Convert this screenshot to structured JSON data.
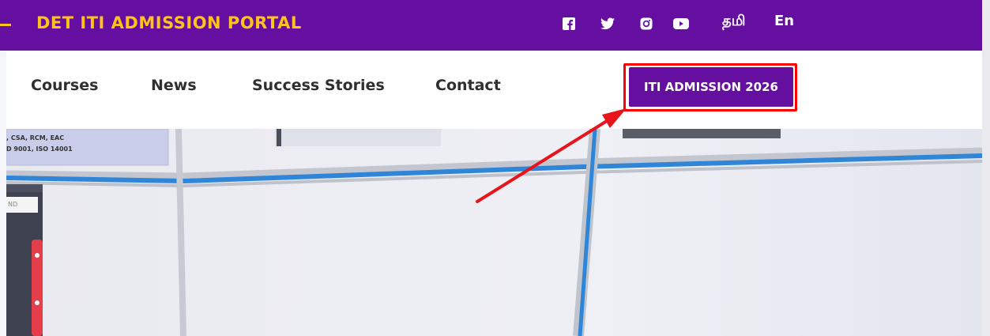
{
  "header": {
    "brand": "DET ITI ADMISSION PORTAL",
    "social_icons": [
      "facebook-icon",
      "twitter-icon",
      "instagram-icon",
      "youtube-icon"
    ],
    "languages": [
      "தமி",
      "En"
    ]
  },
  "nav": {
    "items": [
      "Courses",
      "News",
      "Success Stories",
      "Contact"
    ],
    "cta": "ITI ADMISSION 2026"
  },
  "hero": {
    "board_lines": [
      ", CSA, RCM, EAC",
      "D 9001, ISO 14001"
    ],
    "tag": "ND"
  },
  "colors": {
    "brand_purple": "#650fa0",
    "brand_yellow": "#ffc21a",
    "highlight_red": "#ff0000"
  }
}
